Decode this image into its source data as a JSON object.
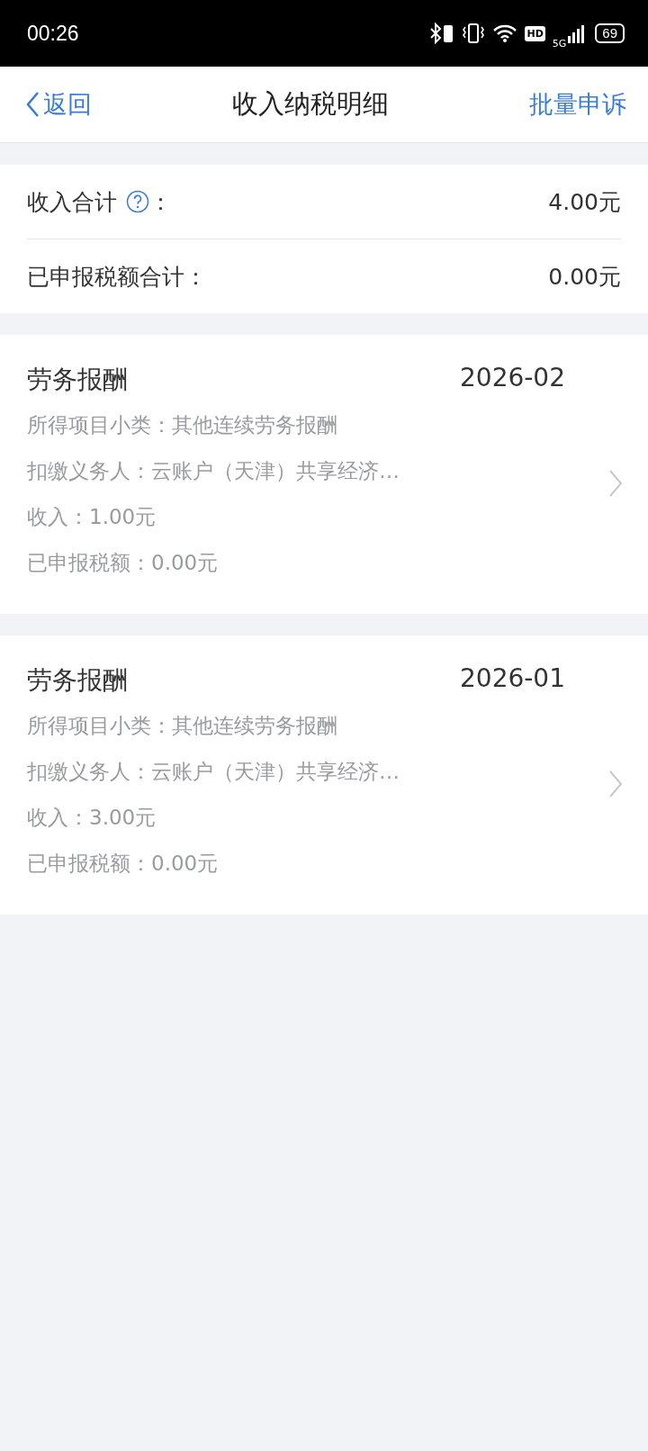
{
  "status_bar": {
    "time": "00:26",
    "hd": "HD",
    "network": "5G",
    "battery": "69"
  },
  "nav": {
    "back": "返回",
    "title": "收入纳税明细",
    "action": "批量申诉"
  },
  "summary": [
    {
      "label": "收入合计",
      "help": true,
      "colon": "：",
      "value": "4.00元"
    },
    {
      "label": "已申报税额合计：",
      "help": false,
      "value": "0.00元"
    }
  ],
  "records": [
    {
      "title": "劳务报酬",
      "date": "2026-02",
      "lines": [
        "所得项目小类：其他连续劳务报酬",
        "扣缴义务人：云账户（天津）共享经济…",
        "收入：1.00元",
        "已申报税额：0.00元"
      ]
    },
    {
      "title": "劳务报酬",
      "date": "2026-01",
      "lines": [
        "所得项目小类：其他连续劳务报酬",
        "扣缴义务人：云账户（天津）共享经济…",
        "收入：3.00元",
        "已申报税额：0.00元"
      ]
    }
  ]
}
